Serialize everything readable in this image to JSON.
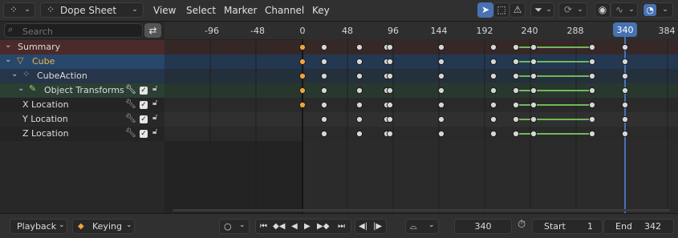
{
  "header": {
    "editor_type_icon": "dope-sheet-icon",
    "mode_label": "Dope Sheet",
    "menus": [
      "View",
      "Select",
      "Marker",
      "Channel",
      "Key"
    ]
  },
  "search": {
    "placeholder": "Search"
  },
  "ruler": {
    "ticks": [
      "-96",
      "-48",
      "0",
      "48",
      "96",
      "144",
      "192",
      "240",
      "288",
      "384"
    ],
    "current_frame": "340"
  },
  "channels": [
    {
      "label": "Summary"
    },
    {
      "label": "Cube"
    },
    {
      "label": "CubeAction"
    },
    {
      "label": "Object Transforms"
    },
    {
      "label": "X Location"
    },
    {
      "label": "Y Location"
    },
    {
      "label": "Z Location"
    }
  ],
  "footer": {
    "playback_label": "Playback",
    "keying_label": "Keying",
    "current_frame": "340",
    "start_label": "Start",
    "start_value": "1",
    "end_label": "End",
    "end_value": "342"
  },
  "colors": {
    "accent": "#4772b3",
    "summary_row": "#4a2a2a",
    "cube_row": "#27476b",
    "action_row": "#263549",
    "transforms_row": "#2b3f33",
    "keyframe": "#d6d6d6",
    "keyframe_selected": "#f0a43b",
    "hold_line": "#6fb85a"
  }
}
